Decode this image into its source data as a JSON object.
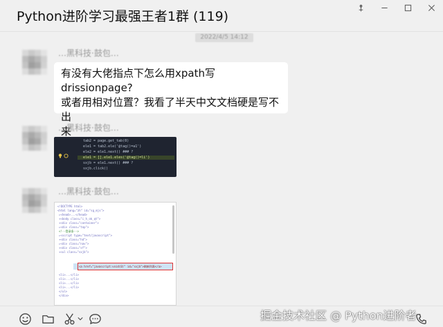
{
  "window": {
    "title": "Python进阶学习最强王者1群 (119)"
  },
  "chat": {
    "timestamp": "2022/4/5 14:12",
    "messages": [
      {
        "sender": "…黑科技·鼓包…",
        "type": "text",
        "text_lines": [
          "有没有大佬指点下怎么用xpath写drissionpage?",
          "或者用相对位置？我看了半天中文文档硬是写不出",
          "来"
        ]
      },
      {
        "sender": "…黑科技·鼓包…",
        "type": "image"
      },
      {
        "sender": "…黑科技·鼓包…",
        "type": "image"
      }
    ]
  },
  "code_snippet": {
    "lines": [
      "tab2 = page.get_tab(0)",
      "ele1 = tab2.ele('@tag()=a1')",
      "ele2 = ele1.next() ### ?",
      "ele1 = [].ele1.eles('@tag()=li')",
      "sxjb = ele1.next() ### ?",
      "sxjb.click()"
    ]
  },
  "html_screenshot": {
    "lines": [
      "<!DOCTYPE html>",
      "<html lang=\"zh\" id=\"sg_mjs\">",
      "▸<head>...</head>",
      "▾<body class=\"i_h_ok_qt\">",
      "  ▾<div class=\"container\">",
      "    ▸<div class=\"top\">",
      "      <!--登录条-->",
      "      ▸<script type=\"text/javascript\">",
      "      ▾<div class=\"hd\">",
      "        ▸<div class=\"nav\">",
      "        ▾<div class=\"sf\">",
      "          ▾<ul class=\"sxjb\">",
      "            <li>...</li>",
      "            <li>...</li>",
      "            <li>...</li>",
      "            <li>...</li>",
      "          </ul>",
      "        </div>"
    ],
    "selected_line": "<a href=\"javascript:void(0)\" id=\"sxjb\">刷新列表</a>"
  },
  "toolbar": {
    "icons": [
      "emoji-icon",
      "folder-icon",
      "scissors-icon",
      "chat-bubble-icon",
      "call-icon"
    ]
  },
  "watermark": {
    "text": "掘金技术社区 @ Python进阶者"
  },
  "colors": {
    "background": "#f0f0f0",
    "bubble": "#ffffff",
    "code_bg": "#1f2430",
    "text": "#111111",
    "muted": "#9a9a9a"
  }
}
